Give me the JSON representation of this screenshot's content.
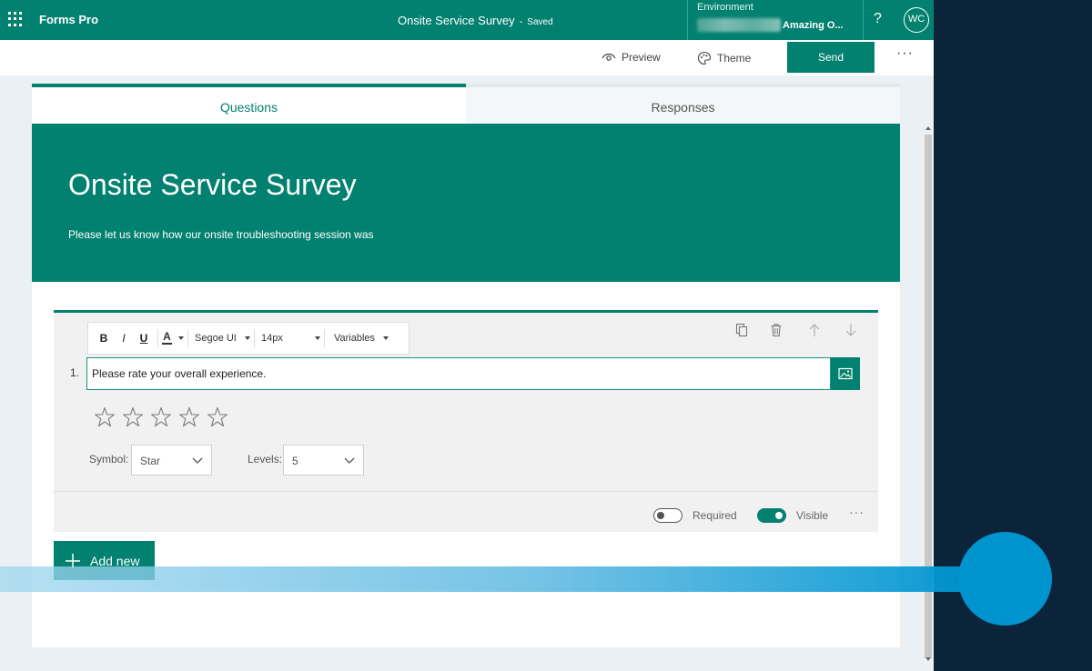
{
  "topbar": {
    "app_name": "Forms Pro",
    "doc_title": "Onsite Service Survey",
    "separator": "-",
    "status": "Saved",
    "env_label": "Environment",
    "env_name": "Amazing O...",
    "help": "?",
    "avatar_initials": "WC"
  },
  "toolbar": {
    "preview_label": "Preview",
    "theme_label": "Theme",
    "send_label": "Send",
    "more": "···"
  },
  "tabs": {
    "questions": "Questions",
    "responses": "Responses"
  },
  "form": {
    "title": "Onsite Service Survey",
    "description": "Please let us know how our onsite troubleshooting session was"
  },
  "question": {
    "number": "1.",
    "text": "Please rate your overall experience.",
    "rte": {
      "bold": "B",
      "italic": "I",
      "underline": "U",
      "font_color": "A",
      "font": "Segoe UI",
      "size": "14px",
      "variables": "Variables"
    },
    "star_count": 5,
    "symbol_label": "Symbol:",
    "symbol_value": "Star",
    "levels_label": "Levels:",
    "levels_value": "5",
    "required_label": "Required",
    "required": false,
    "visible_label": "Visible",
    "visible": true,
    "more": "···"
  },
  "add_new_label": "Add new",
  "colors": {
    "accent": "#038170",
    "background": "#eaf0f3",
    "right_panel": "#0b2439",
    "overlay_blue": "#0094ce"
  }
}
